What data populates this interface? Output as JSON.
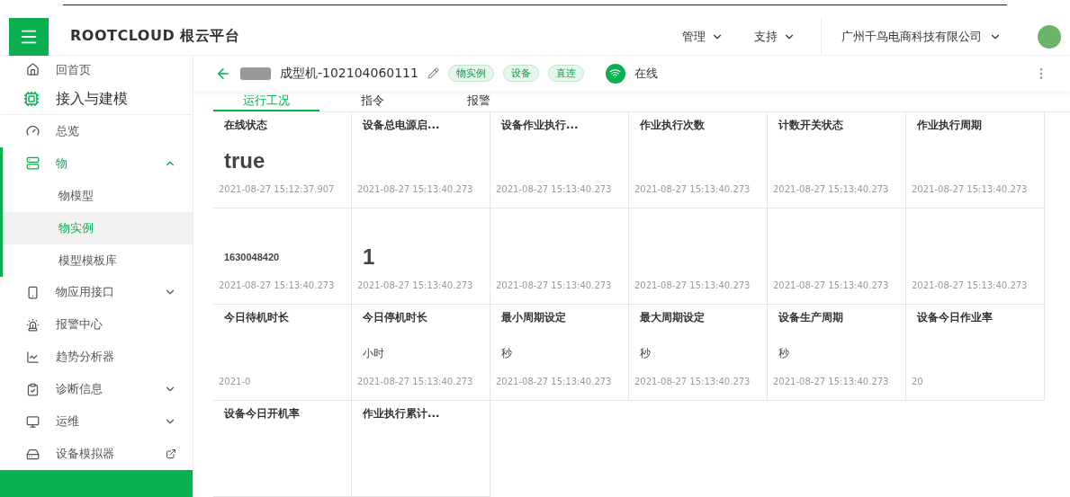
{
  "header": {
    "logo": "ROOTCLOUD 根云平台",
    "menus": [
      "管理",
      "支持"
    ],
    "organization": "广州千鸟电商科技有限公司"
  },
  "sidebar": {
    "home": "回首页",
    "section": "接入与建模",
    "items": [
      {
        "label": "总览",
        "kind": "plain",
        "selected": false
      },
      {
        "label": "物",
        "kind": "group",
        "selected": true,
        "expanded": true,
        "children": [
          {
            "label": "物模型",
            "selected": false
          },
          {
            "label": "物实例",
            "selected": true
          },
          {
            "label": "模型模板库",
            "selected": false
          }
        ]
      },
      {
        "label": "物应用接口",
        "kind": "group",
        "selected": false,
        "expanded": false
      },
      {
        "label": "报警中心",
        "kind": "plain",
        "selected": false
      },
      {
        "label": "趋势分析器",
        "kind": "plain",
        "selected": false
      },
      {
        "label": "诊断信息",
        "kind": "group",
        "selected": false,
        "expanded": false
      },
      {
        "label": "运维",
        "kind": "group",
        "selected": false,
        "expanded": false
      },
      {
        "label": "设备模拟器",
        "kind": "external",
        "selected": false
      }
    ]
  },
  "device": {
    "title": "成型机-102104060111",
    "tags": [
      "物实例",
      "设备",
      "直连"
    ],
    "status": "在线"
  },
  "tabs": [
    {
      "label": "运行工况",
      "selected": true
    },
    {
      "label": "指令",
      "selected": false
    },
    {
      "label": "报警",
      "selected": false
    }
  ],
  "cards": [
    {
      "label": "在线状态",
      "value": "true",
      "timestamp": "2021-08-27 15:12:37.907"
    },
    {
      "label": "设备总电源启...",
      "timestamp": "2021-08-27 15:13:40.273"
    },
    {
      "label": "设备作业执行...",
      "timestamp": "2021-08-27 15:13:40.273"
    },
    {
      "label": "作业执行次数",
      "timestamp": "2021-08-27 15:13:40.273"
    },
    {
      "label": "计数开关状态",
      "timestamp": "2021-08-27 15:13:40.273"
    },
    {
      "label": "作业执行周期",
      "timestamp": "2021-08-27 15:13:40.273"
    },
    {
      "value": "1630048420",
      "timestamp": "2021-08-27 15:13:40.273"
    },
    {
      "value": "1",
      "timestamp": "2021-08-27 15:13:40.273"
    },
    {
      "timestamp": "2021-08-27 15:13:40.273"
    },
    {
      "timestamp": "2021-08-27 15:13:40.273"
    },
    {
      "timestamp": "2021-08-27 15:13:40.273"
    },
    {
      "timestamp": "2021-08-27 15:13:40.273"
    },
    {
      "label": "今日待机时长",
      "timestamp": "2021-0"
    },
    {
      "label": "今日停机时长",
      "unit": "小时",
      "timestamp": "2021-08-27 15:13:40.273"
    },
    {
      "label": "最小周期设定",
      "unit": "秒",
      "timestamp": "2021-08-27 15:13:40.273"
    },
    {
      "label": "最大周期设定",
      "unit": "秒",
      "timestamp": "2021-08-27 15:13:40.273"
    },
    {
      "label": "设备生产周期",
      "unit": "秒",
      "timestamp": "2021-08-27 15:13:40.273"
    },
    {
      "label": "设备今日作业率",
      "timestamp": "20"
    },
    {
      "label": "设备今日开机率"
    },
    {
      "label": "作业执行累计..."
    }
  ]
}
